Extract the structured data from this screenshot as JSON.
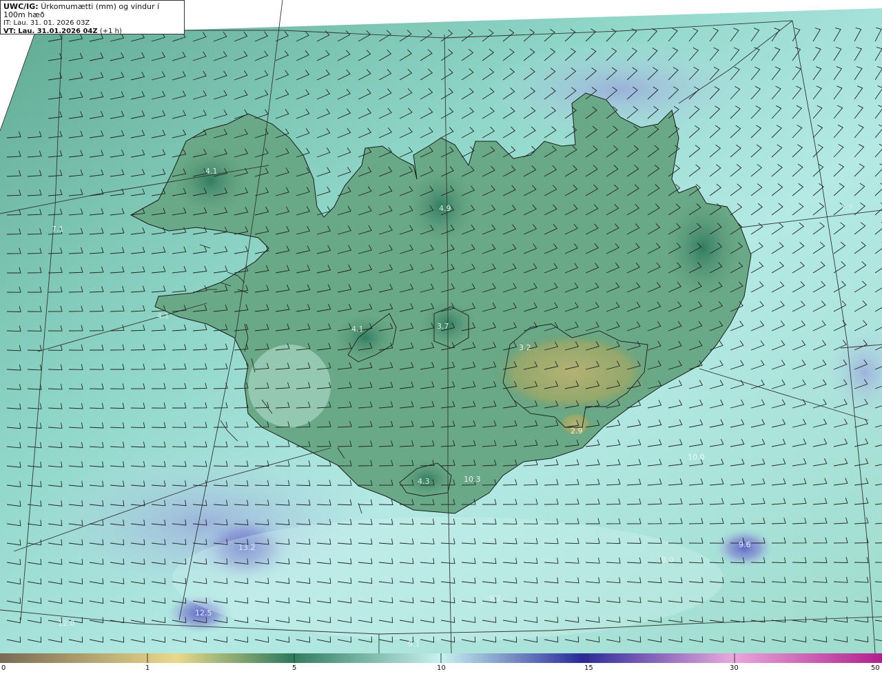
{
  "header": {
    "model": "UWC/IG:",
    "title": "Úrkomumætti (mm) og vindur í 100m hæð",
    "it_label": "IT:",
    "it_value": "Lau. 31. 01. 2026 03Z",
    "vt_label": "VT:",
    "vt_value": "Lau. 31.01.2026 04Z",
    "vt_offset": "(+1 h)"
  },
  "colors": {
    "sea_low": "#8ed3c6",
    "sea_high": "#c4f0ee",
    "blue_zone": "#8a97d4",
    "deep_blue": "#5c66c4",
    "land_green": "#5f9c7c",
    "dark_green": "#2f7a5d",
    "olive": "#a5ad6a",
    "coast": "#1a1a1a",
    "grid": "#333333"
  },
  "labels": [
    {
      "text": "4.1"
    },
    {
      "text": "7.1"
    },
    {
      "text": "4.9"
    },
    {
      "text": "7.7"
    },
    {
      "text": "4.1"
    },
    {
      "text": "4.1"
    },
    {
      "text": "3.7"
    },
    {
      "text": "3.2"
    },
    {
      "text": "2.9"
    },
    {
      "text": "10.0"
    },
    {
      "text": "4.3"
    },
    {
      "text": "10.3"
    },
    {
      "text": "13.2"
    },
    {
      "text": "8.0"
    },
    {
      "text": "9.6"
    },
    {
      "text": "12.5"
    },
    {
      "text": "12.0"
    },
    {
      "text": "9.2"
    },
    {
      "text": "9.1"
    }
  ],
  "colorbar": {
    "stops": [
      {
        "v": "0",
        "color": "#7b6a55"
      },
      {
        "v": "1",
        "color": "#e8da8a"
      },
      {
        "v": "5",
        "color": "#2f7a5d"
      },
      {
        "v": "10",
        "color": "#c8f2f0"
      },
      {
        "v": "15",
        "color": "#2a2a9a"
      },
      {
        "v": "30",
        "color": "#e8a8dc"
      },
      {
        "v": "50",
        "color": "#b0208c"
      }
    ],
    "ticks": [
      "0",
      "1",
      "5",
      "10",
      "15",
      "30",
      "50"
    ]
  }
}
